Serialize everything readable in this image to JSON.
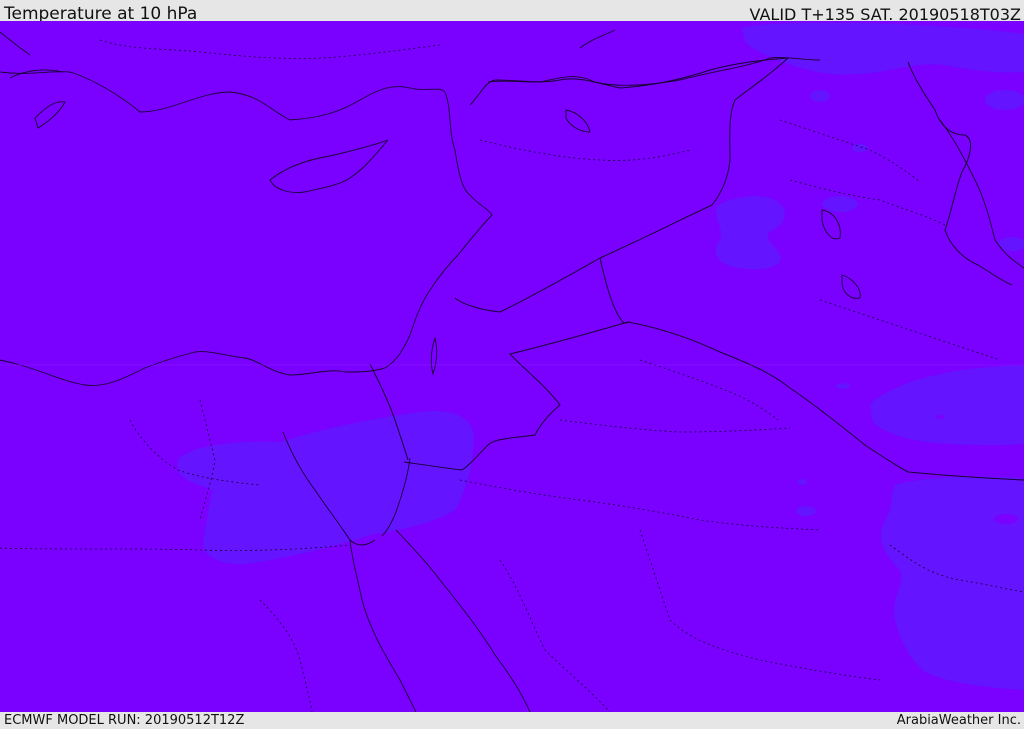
{
  "header": {
    "title": "Temperature at 10 hPa",
    "valid_time": "VALID T+135 SAT. 20190518T03Z"
  },
  "footer": {
    "model_run": "ECMWF MODEL RUN: 20190512T12Z",
    "credit": "ArabiaWeather Inc."
  },
  "map": {
    "field": "Temperature at 10 hPa",
    "colors": {
      "base_fill": "#7a00ff",
      "warmer_band_fill": "#6414ff",
      "coastline": "#1a0033",
      "border": "#1a0033"
    }
  }
}
